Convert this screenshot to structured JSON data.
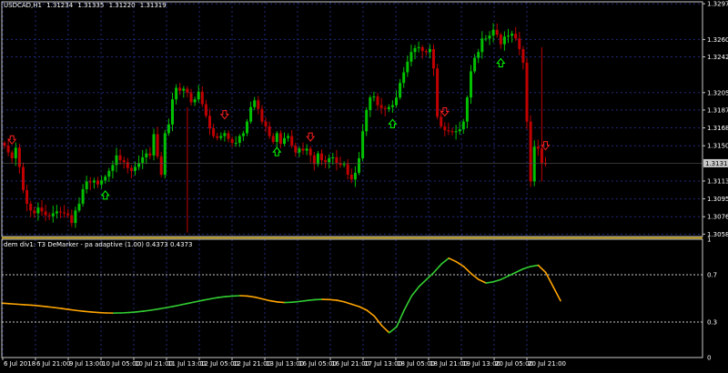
{
  "window": {
    "symbol_tf": "USDCAD,H1",
    "ohlc": [
      "1.31234",
      "1.31335",
      "1.31220",
      "1.31319"
    ]
  },
  "indicator": {
    "title": "dem div1: T3 DeMarker - pa adaptive (1.00) 0.4373 0.4373"
  },
  "colors": {
    "background": "#000000",
    "grid": "#1f2a7a",
    "frame": "#c8c8c8",
    "bull": "#00c000",
    "bear": "#c00000",
    "up_arrow": "#00ff00",
    "down_arrow": "#ff2020",
    "line_up": "#32cd32",
    "line_down": "#ffa500",
    "level_line": "#c8c8c8",
    "separator": "#c8a000",
    "price_label_bg": "#c8c8c8"
  },
  "price_axis": {
    "ticks": [
      "1.32970",
      "1.32600",
      "1.32420",
      "1.32050",
      "1.31870",
      "1.31685",
      "1.31500",
      "1.31135",
      "1.30950",
      "1.30765",
      "1.30585"
    ],
    "current_price": "1.31319"
  },
  "indicator_axis": {
    "ticks": [
      "1",
      "0.7",
      "0.3",
      "0"
    ],
    "levels": [
      0.7,
      0.3
    ]
  },
  "time_axis": {
    "labels": [
      "6 Jul 2018",
      "6 Jul 21:00",
      "9 Jul 13:00",
      "10 Jul 05:00",
      "10 Jul 21:00",
      "11 Jul 13:00",
      "12 Jul 05:00",
      "12 Jul 21:00",
      "13 Jul 13:00",
      "16 Jul 05:00",
      "16 Jul 21:00",
      "17 Jul 13:00",
      "18 Jul 05:00",
      "18 Jul 21:00",
      "19 Jul 13:00",
      "20 Jul 05:00",
      "20 Jul 21:00"
    ]
  },
  "chart_data": {
    "type": "candlestick",
    "price_range": [
      1.3056,
      1.3299
    ],
    "closes": [
      1.315,
      1.3143,
      1.3137,
      1.3148,
      1.3128,
      1.3104,
      1.309,
      1.3083,
      1.308,
      1.3086,
      1.3082,
      1.3078,
      1.3077,
      1.308,
      1.3082,
      1.3081,
      1.308,
      1.3078,
      1.307,
      1.3083,
      1.309,
      1.3105,
      1.3113,
      1.3112,
      1.3114,
      1.311,
      1.3114,
      1.3118,
      1.3124,
      1.313,
      1.314,
      1.3135,
      1.3133,
      1.3127,
      1.3124,
      1.3128,
      1.3132,
      1.3138,
      1.3142,
      1.314,
      1.3162,
      1.3139,
      1.312,
      1.3163,
      1.3172,
      1.3198,
      1.321,
      1.3207,
      1.3209,
      1.3205,
      1.3195,
      1.3198,
      1.3206,
      1.3193,
      1.3181,
      1.3168,
      1.316,
      1.3158,
      1.316,
      1.3163,
      1.3157,
      1.3153,
      1.3153,
      1.316,
      1.3163,
      1.3175,
      1.319,
      1.3197,
      1.3188,
      1.3175,
      1.317,
      1.316,
      1.3154,
      1.3163,
      1.3152,
      1.3158,
      1.316,
      1.315,
      1.3143,
      1.3147,
      1.3145,
      1.3147,
      1.314,
      1.3131,
      1.3142,
      1.3135,
      1.3133,
      1.3137,
      1.3138,
      1.3132,
      1.313,
      1.3131,
      1.312,
      1.3115,
      1.3122,
      1.3137,
      1.3165,
      1.3187,
      1.32,
      1.3201,
      1.3192,
      1.3189,
      1.3188,
      1.319,
      1.3192,
      1.32,
      1.3215,
      1.3226,
      1.3237,
      1.3247,
      1.3251,
      1.3252,
      1.3248,
      1.3247,
      1.325,
      1.323,
      1.318,
      1.317,
      1.3166,
      1.3165,
      1.3164,
      1.3165,
      1.3167,
      1.3175,
      1.32,
      1.3227,
      1.3241,
      1.3247,
      1.3261,
      1.3261,
      1.3264,
      1.327,
      1.3265,
      1.3255,
      1.3263,
      1.3264,
      1.3266,
      1.3261,
      1.325,
      1.3236,
      1.3175,
      1.3113,
      1.3149,
      1.3147,
      1.3132,
      1.3131
    ],
    "down_signals": [
      2,
      59,
      82,
      118,
      145
    ],
    "up_signals": [
      27,
      73,
      104,
      133
    ],
    "indicator": [
      0.46,
      0.455,
      0.451,
      0.447,
      0.443,
      0.437,
      0.43,
      0.423,
      0.415,
      0.406,
      0.398,
      0.391,
      0.385,
      0.38,
      0.377,
      0.376,
      0.377,
      0.38,
      0.385,
      0.392,
      0.4,
      0.41,
      0.421,
      0.432,
      0.445,
      0.458,
      0.471,
      0.484,
      0.496,
      0.507,
      0.515,
      0.52,
      0.523,
      0.52,
      0.51,
      0.495,
      0.48,
      0.47,
      0.465,
      0.468,
      0.474,
      0.482,
      0.489,
      0.492,
      0.49,
      0.484,
      0.47,
      0.45,
      0.43,
      0.4,
      0.35,
      0.27,
      0.21,
      0.26,
      0.4,
      0.52,
      0.6,
      0.66,
      0.72,
      0.79,
      0.84,
      0.81,
      0.77,
      0.71,
      0.66,
      0.63,
      0.64,
      0.66,
      0.69,
      0.72,
      0.75,
      0.77,
      0.78,
      0.72,
      0.6,
      0.48
    ]
  }
}
